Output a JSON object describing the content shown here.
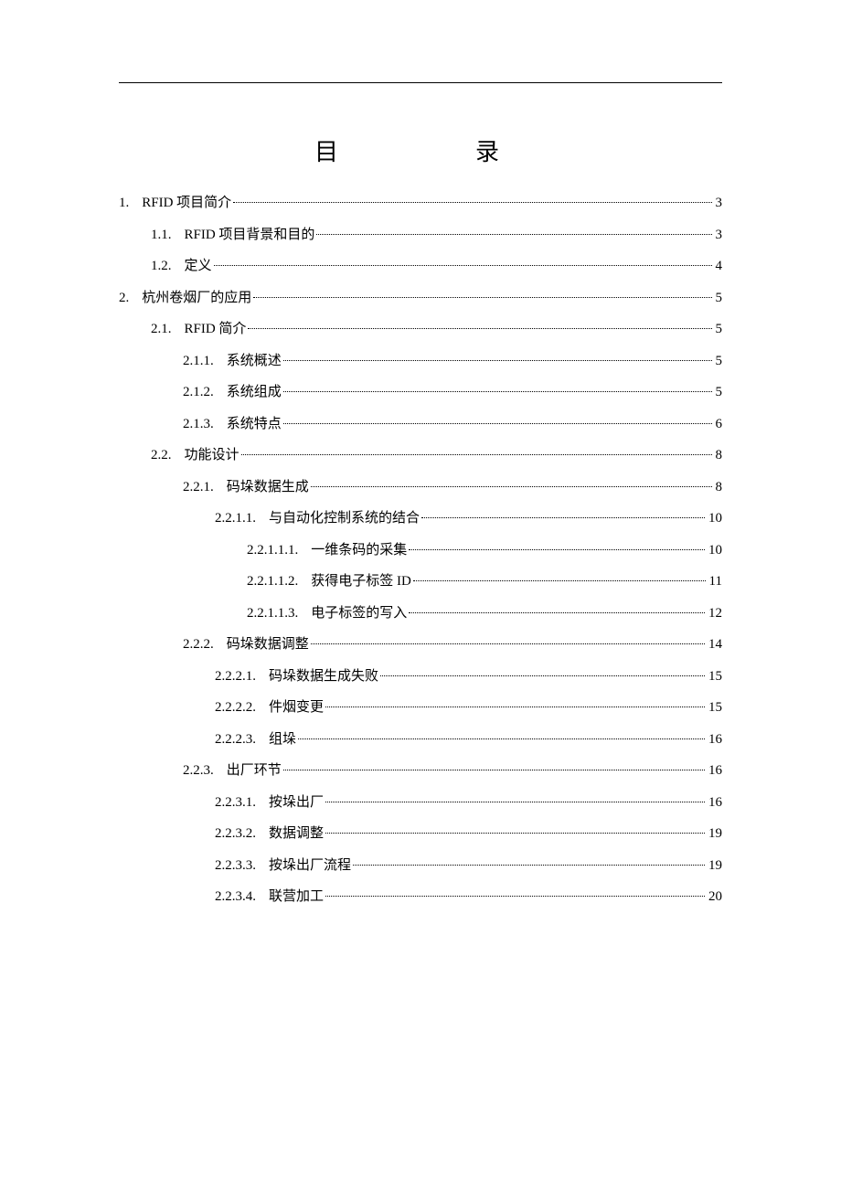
{
  "title": "目录",
  "toc": [
    {
      "indent": 0,
      "num": "1. ",
      "label": "RFID 项目简介",
      "page": "3"
    },
    {
      "indent": 35,
      "num": "1.1.",
      "label": "RFID 项目背景和目的",
      "page": "3"
    },
    {
      "indent": 35,
      "num": "1.2.",
      "label": "定义",
      "page": "4"
    },
    {
      "indent": 0,
      "num": "2.",
      "label": "杭州卷烟厂的应用",
      "page": "5"
    },
    {
      "indent": 35,
      "num": "2.1.",
      "label": "RFID 简介",
      "page": "5"
    },
    {
      "indent": 70,
      "num": "2.1.1.",
      "label": "系统概述",
      "page": "5"
    },
    {
      "indent": 70,
      "num": "2.1.2.",
      "label": "系统组成",
      "page": "5"
    },
    {
      "indent": 70,
      "num": "2.1.3.",
      "label": "系统特点",
      "page": "6"
    },
    {
      "indent": 35,
      "num": "2.2.",
      "label": "功能设计",
      "page": "8"
    },
    {
      "indent": 70,
      "num": "2.2.1.",
      "label": "码垛数据生成",
      "page": "8"
    },
    {
      "indent": 105,
      "num": "2.2.1.1.",
      "label": "与自动化控制系统的结合",
      "page": "10"
    },
    {
      "indent": 140,
      "num": "2.2.1.1.1.",
      "label": "一维条码的采集",
      "page": "10"
    },
    {
      "indent": 140,
      "num": "2.2.1.1.2.",
      "label": "获得电子标签 ID",
      "page": "11"
    },
    {
      "indent": 140,
      "num": "2.2.1.1.3.",
      "label": "电子标签的写入",
      "page": "12"
    },
    {
      "indent": 70,
      "num": "2.2.2.",
      "label": "码垛数据调整",
      "page": "14"
    },
    {
      "indent": 105,
      "num": "2.2.2.1.",
      "label": "码垛数据生成失败",
      "page": "15"
    },
    {
      "indent": 105,
      "num": "2.2.2.2.",
      "label": "件烟变更",
      "page": "15"
    },
    {
      "indent": 105,
      "num": "2.2.2.3.",
      "label": "组垛",
      "page": "16"
    },
    {
      "indent": 70,
      "num": "2.2.3.",
      "label": "出厂环节",
      "page": "16"
    },
    {
      "indent": 105,
      "num": "2.2.3.1.",
      "label": "按垛出厂",
      "page": "16"
    },
    {
      "indent": 105,
      "num": "2.2.3.2.",
      "label": "数据调整",
      "page": "19"
    },
    {
      "indent": 105,
      "num": "2.2.3.3.",
      "label": "按垛出厂流程",
      "page": "19"
    },
    {
      "indent": 105,
      "num": "2.2.3.4.",
      "label": "联营加工",
      "page": "20"
    }
  ]
}
